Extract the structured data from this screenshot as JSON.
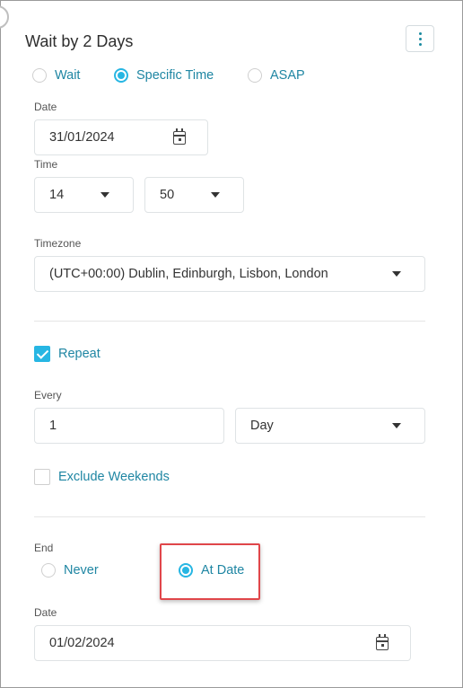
{
  "header": {
    "title": "Wait by 2 Days",
    "menu_icon": "more-vertical-icon"
  },
  "mode": {
    "options": [
      {
        "label": "Wait",
        "selected": false
      },
      {
        "label": "Specific Time",
        "selected": true
      },
      {
        "label": "ASAP",
        "selected": false
      }
    ]
  },
  "date": {
    "label": "Date",
    "value": "31/01/2024",
    "icon": "calendar-icon"
  },
  "time": {
    "label": "Time",
    "hour": "14",
    "minute": "50"
  },
  "timezone": {
    "label": "Timezone",
    "value": "(UTC+00:00) Dublin, Edinburgh, Lisbon, London"
  },
  "repeat": {
    "label": "Repeat",
    "checked": true
  },
  "every": {
    "label": "Every",
    "count": "1",
    "unit": "Day"
  },
  "exclude_weekends": {
    "label": "Exclude Weekends",
    "checked": false
  },
  "end": {
    "label": "End",
    "options": [
      {
        "label": "Never",
        "selected": false
      },
      {
        "label": "At Date",
        "selected": true
      }
    ],
    "date_label": "Date",
    "date_value": "01/02/2024"
  },
  "colors": {
    "accent": "#27b6e3",
    "link": "#1f86a3",
    "highlight": "#e0464a"
  }
}
